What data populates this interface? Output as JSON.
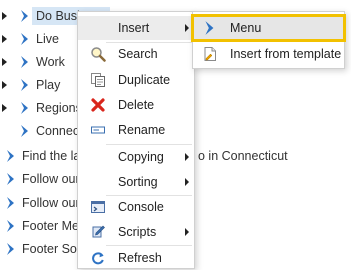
{
  "tree": {
    "items": [
      {
        "label": "Do Business",
        "expandable": true
      },
      {
        "label": "Live",
        "expandable": true
      },
      {
        "label": "Work",
        "expandable": true
      },
      {
        "label": "Play",
        "expandable": true
      },
      {
        "label": "Regions",
        "expandable": true
      },
      {
        "label": "Connect",
        "expandable": false
      },
      {
        "label": "Find the lat",
        "expandable": false
      },
      {
        "label": "Follow our",
        "expandable": false
      },
      {
        "label": "Follow our",
        "expandable": false
      },
      {
        "label": "Footer Men",
        "expandable": false
      },
      {
        "label": "Footer Soc",
        "expandable": false
      }
    ],
    "find_latest_suffix": "o in Connecticut"
  },
  "context_menu": {
    "items": [
      {
        "label": "Insert",
        "icon": "none",
        "submenu": true
      },
      {
        "label": "Search",
        "icon": "magnifier-icon",
        "submenu": false
      },
      {
        "label": "Duplicate",
        "icon": "duplicate-icon",
        "submenu": false
      },
      {
        "label": "Delete",
        "icon": "red-x-icon",
        "submenu": false
      },
      {
        "label": "Rename",
        "icon": "rename-icon",
        "submenu": false
      },
      {
        "label": "Copying",
        "icon": "none",
        "submenu": true
      },
      {
        "label": "Sorting",
        "icon": "none",
        "submenu": true
      },
      {
        "label": "Console",
        "icon": "console-icon",
        "submenu": false
      },
      {
        "label": "Scripts",
        "icon": "scripts-icon",
        "submenu": true
      },
      {
        "label": "Refresh",
        "icon": "refresh-icon",
        "submenu": false
      }
    ]
  },
  "submenu": {
    "items": [
      {
        "label": "Menu",
        "icon": "chevron-icon"
      },
      {
        "label": "Insert from template",
        "icon": "template-icon"
      }
    ]
  },
  "colors": {
    "selection": "#d6e6f5",
    "chevron": "#2e73c4",
    "focus_outline": "#f2c100",
    "delete_red": "#d9261c"
  }
}
